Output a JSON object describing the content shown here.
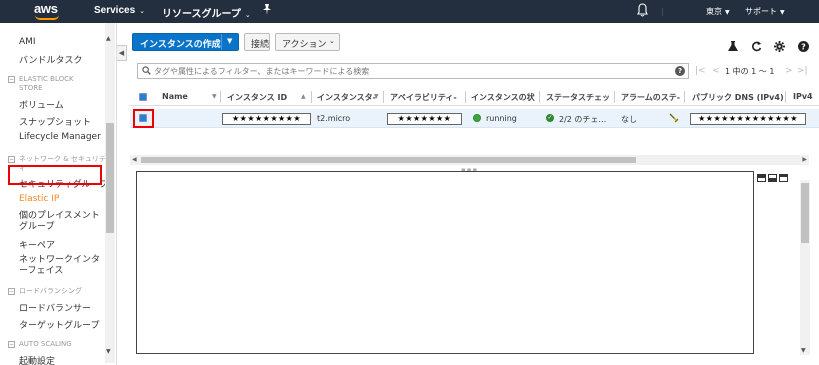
{
  "topbar": {
    "logo": "aws",
    "services": "Services",
    "resource_groups": "リソースグループ",
    "region": "東京",
    "support": "サポート",
    "icons": [
      "pin-icon",
      "bell-icon"
    ]
  },
  "sidebar": {
    "items_top": [
      "AMI",
      "バンドルタスク"
    ],
    "sections": [
      {
        "title": "ELASTIC BLOCK STORE",
        "items": [
          "ボリューム",
          "スナップショット",
          "Lifecycle Manager"
        ]
      },
      {
        "title": "ネットワーク & セキュリティ",
        "items": [
          "セキュリティグループ",
          "Elastic IP",
          "個のプレイスメントグループ",
          "キーペア",
          "ネットワークインターフェイス"
        ]
      },
      {
        "title": "ロードバランシング",
        "items": [
          "ロードバランサー",
          "ターゲットグループ"
        ]
      },
      {
        "title": "AUTO SCALING",
        "items": [
          "起動設定"
        ]
      }
    ],
    "active_item": "Elastic IP"
  },
  "toolbar": {
    "launch_label": "インスタンスの作成",
    "connect_label": "接続",
    "actions_label": "アクション",
    "icons": [
      "flask-icon",
      "refresh-icon",
      "gear-icon",
      "help-icon"
    ]
  },
  "search": {
    "placeholder": "タグや属性によるフィルター、またはキーワードによる検索",
    "help": "?"
  },
  "pagination": {
    "text": "1 中の 1 ～ 1"
  },
  "table": {
    "headers": [
      "Name",
      "インスタンス ID",
      "インスタンスタ-",
      "アベイラビリティ-",
      "インスタンスの状",
      "ステータスチェッ",
      "アラームのステ-",
      "パブリック DNS (IPv4)",
      "IPv4"
    ],
    "rows": [
      {
        "name": "",
        "instance_id": "★★★★★★★★★",
        "instance_type": "t2.micro",
        "availability_zone": "★★★★★★★",
        "state": "running",
        "status_checks": "2/2 のチェ…",
        "alarm_status": "なし",
        "public_dns": "★★★★★★★★★★★★★",
        "state_color": "#3da63d"
      }
    ]
  },
  "colors": {
    "topbar_bg": "#232f3e",
    "accent_orange": "#ff9900",
    "primary_button": "#0a74c9",
    "highlight_red": "#ee0000",
    "selected_row": "#eaf3fc"
  }
}
